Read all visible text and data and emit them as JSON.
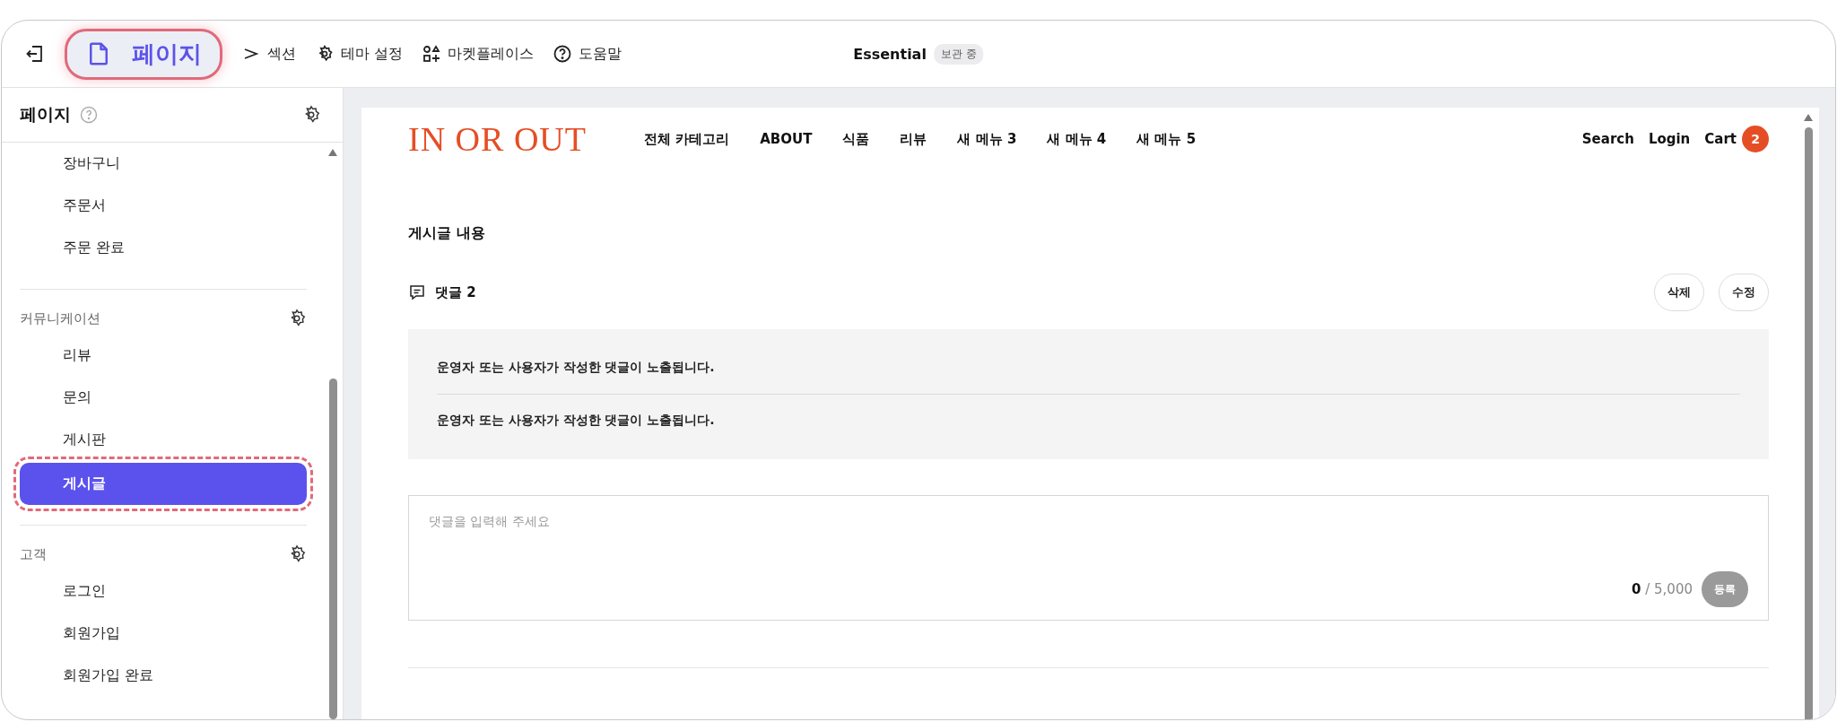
{
  "toolbar": {
    "items": [
      {
        "label": "페이지",
        "selected": true
      },
      {
        "label": "섹션",
        "selected": false
      },
      {
        "label": "테마 설정",
        "selected": false
      },
      {
        "label": "마켓플레이스",
        "selected": false
      },
      {
        "label": "도움말",
        "selected": false
      }
    ],
    "theme_name": "Essential",
    "theme_status": "보관 중"
  },
  "sidebar": {
    "title": "페이지",
    "groups": [
      {
        "items": [
          {
            "label": "장바구니",
            "selected": false
          },
          {
            "label": "주문서",
            "selected": false
          },
          {
            "label": "주문 완료",
            "selected": false
          }
        ]
      },
      {
        "title": "커뮤니케이션",
        "items": [
          {
            "label": "리뷰",
            "selected": false
          },
          {
            "label": "문의",
            "selected": false
          },
          {
            "label": "게시판",
            "selected": false
          },
          {
            "label": "게시글",
            "selected": true
          }
        ]
      },
      {
        "title": "고객",
        "items": [
          {
            "label": "로그인",
            "selected": false
          },
          {
            "label": "회원가입",
            "selected": false
          },
          {
            "label": "회원가입 완료",
            "selected": false
          }
        ]
      }
    ]
  },
  "preview": {
    "logo": "IN OR OUT",
    "nav": [
      "전체 카테고리",
      "ABOUT",
      "식품",
      "리뷰",
      "새 메뉴 3",
      "새 메뉴 4",
      "새 메뉴 5"
    ],
    "utility": {
      "search": "Search",
      "login": "Login",
      "cart": "Cart",
      "cart_count": "2"
    },
    "post_title": "게시글 내용",
    "comments_label": "댓글 2",
    "actions": [
      "삭제",
      "수정"
    ],
    "comments": [
      "운영자 또는 사용자가 작성한 댓글이 노출됩니다.",
      "운영자 또는 사용자가 작성한 댓글이 노출됩니다."
    ],
    "comment_input": {
      "placeholder": "댓글을 입력해 주세요",
      "count": "0",
      "limit": "/ 5,000",
      "submit": "등록"
    }
  }
}
